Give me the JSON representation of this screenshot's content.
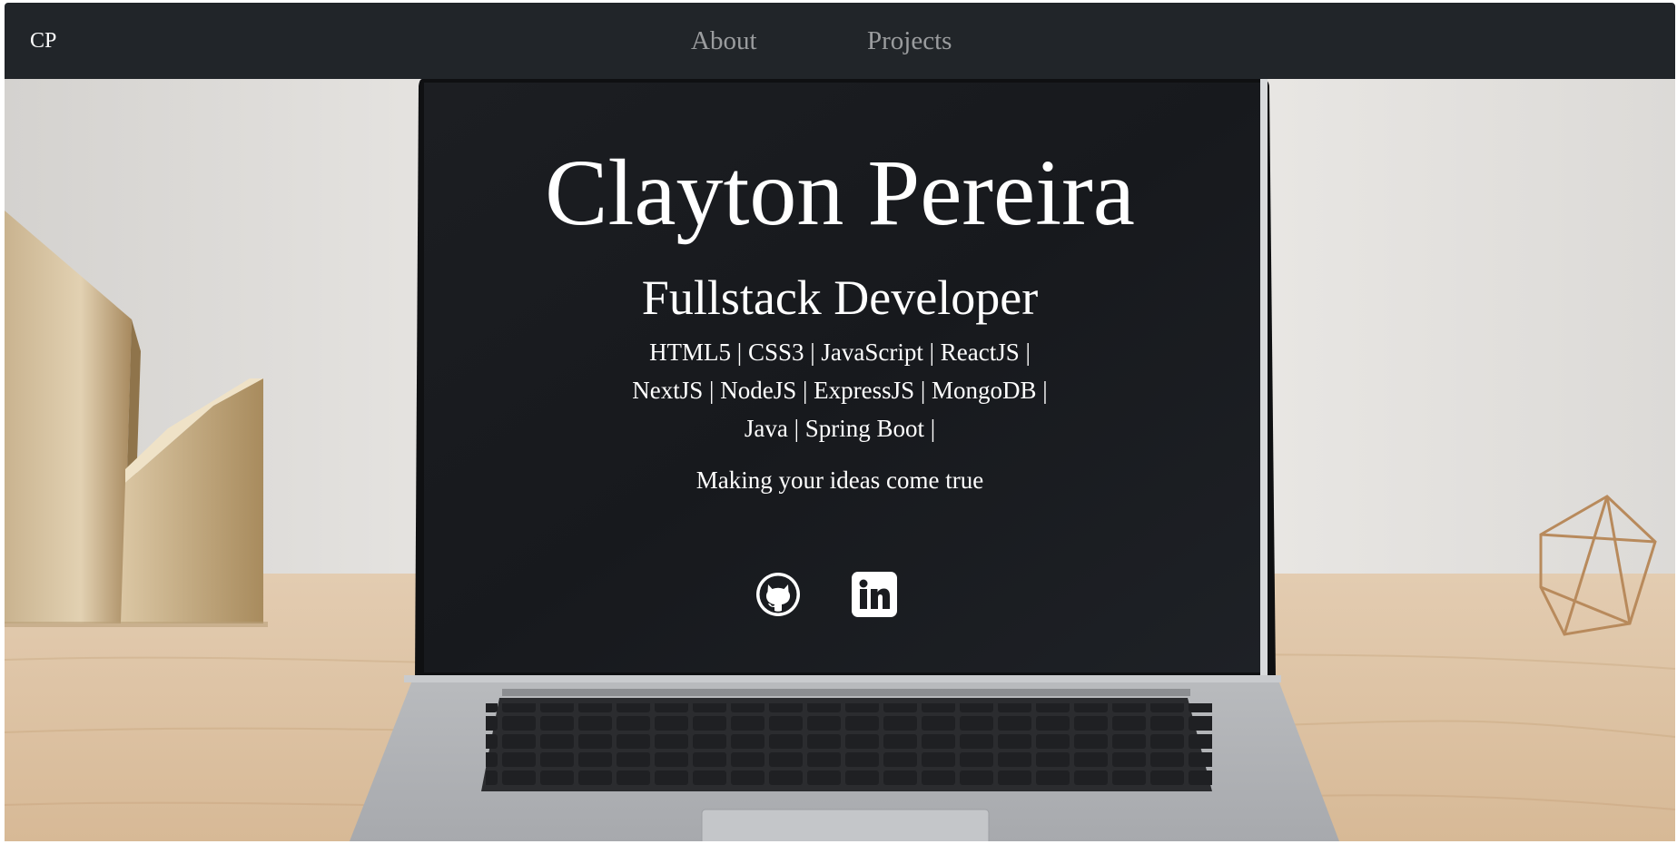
{
  "navbar": {
    "brand": "CP",
    "links": [
      {
        "label": "About"
      },
      {
        "label": "Projects"
      }
    ]
  },
  "hero": {
    "name": "Clayton Pereira",
    "role": "Fullstack Developer",
    "skills": "HTML5 | CSS3 | JavaScript | ReactJS | NextJS | NodeJS | ExpressJS | MongoDB | Java | Spring Boot |",
    "tagline": "Making your ideas come true",
    "social": [
      {
        "icon": "github-icon"
      },
      {
        "icon": "linkedin-icon"
      }
    ]
  },
  "colors": {
    "navbar_bg": "#212529",
    "nav_link": "rgba(255,255,255,0.55)",
    "text": "#ffffff",
    "screen": "#191b1f",
    "wall": "#e6e4e1",
    "desk": "#dcc3a6"
  }
}
